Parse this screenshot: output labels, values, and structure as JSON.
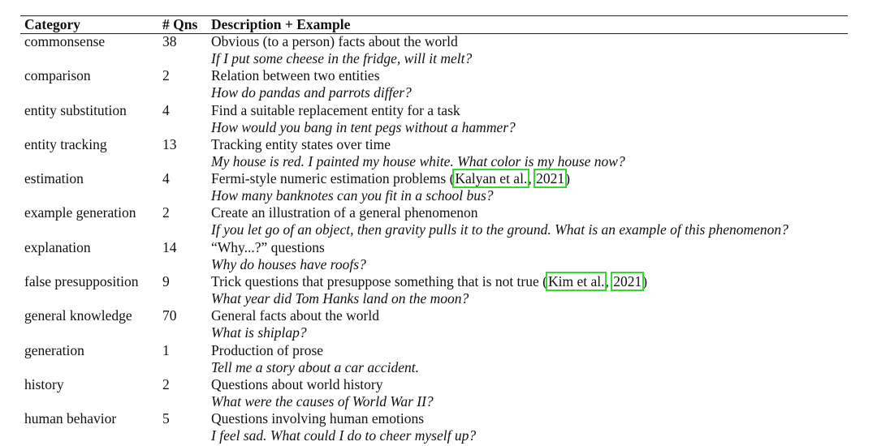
{
  "header": {
    "category": "Category",
    "qns": "# Qns",
    "description": "Description + Example"
  },
  "rows": [
    {
      "category": "commonsense",
      "qns": "38",
      "description": "Obvious (to a person) facts about the world",
      "example": "If I put some cheese in the fridge, will it melt?"
    },
    {
      "category": "comparison",
      "qns": "2",
      "description": "Relation between two entities",
      "example": "How do pandas and parrots differ?"
    },
    {
      "category": "entity substitution",
      "qns": "4",
      "description": "Find a suitable replacement entity for a task",
      "example": "How would you bang in tent pegs without a hammer?"
    },
    {
      "category": "entity tracking",
      "qns": "13",
      "description": "Tracking entity states over time",
      "example": "My house is red. I painted my house white. What color is my house now?"
    },
    {
      "category": "estimation",
      "qns": "4",
      "description": "Fermi-style numeric estimation problems",
      "citation": {
        "open": " (",
        "author": "Kalyan et al.",
        "sep": ", ",
        "year": "2021",
        "close": ")"
      },
      "example": "How many banknotes can you fit in a school bus?"
    },
    {
      "category": "example generation",
      "qns": "2",
      "description": "Create an illustration of a general phenomenon",
      "example": "If you let go of an object, then gravity pulls it to the ground. What is an example of this phenomenon?"
    },
    {
      "category": "explanation",
      "qns": "14",
      "description": "“Why...?” questions",
      "example": "Why do houses have roofs?"
    },
    {
      "category": "false presupposition",
      "qns": "9",
      "description": "Trick questions that presuppose something that is not true",
      "citation": {
        "open": " (",
        "author": "Kim et al.",
        "sep": ", ",
        "year": "2021",
        "close": ")"
      },
      "example": "What year did Tom Hanks land on the moon?"
    },
    {
      "category": "general knowledge",
      "qns": "70",
      "description": "General facts about the world",
      "example": "What is shiplap?"
    },
    {
      "category": "generation",
      "qns": "1",
      "description": "Production of prose",
      "example": "Tell me a story about a car accident."
    },
    {
      "category": "history",
      "qns": "2",
      "description": "Questions about world history",
      "example": "What were the causes of World War II?"
    },
    {
      "category": "human behavior",
      "qns": "5",
      "description": "Questions involving human emotions",
      "example": "I feel sad. What could I do to cheer myself up?"
    }
  ],
  "colors": {
    "citation_box": "#35d635",
    "text": "#111111"
  }
}
